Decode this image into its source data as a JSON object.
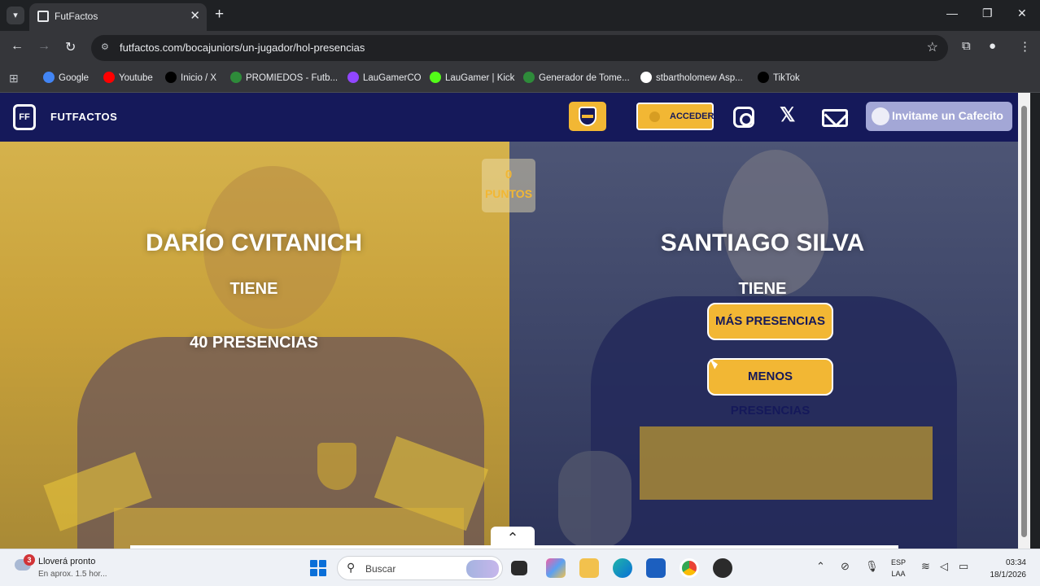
{
  "browser": {
    "tab_title": "FutFactos",
    "tab_close": "✕",
    "new_tab": "+",
    "tab_list_icon": "chevron-down-icon",
    "url": "futfactos.com/bocajuniors/un-jugador/hol-presencias",
    "window": {
      "minimize": "—",
      "maximize": "❐",
      "close": "✕"
    }
  },
  "bookmarks": [
    {
      "label": "Google",
      "icon": "google-icon",
      "color": "#4285f4"
    },
    {
      "label": "Youtube",
      "icon": "youtube-icon",
      "color": "#ff0000"
    },
    {
      "label": "Inicio / X",
      "icon": "x-icon",
      "color": "#000000"
    },
    {
      "label": "PROMIEDOS - Futb...",
      "icon": "promiedos-icon",
      "color": "#2e8b3a"
    },
    {
      "label": "LauGamerCO",
      "icon": "twitch-icon",
      "color": "#9146ff"
    },
    {
      "label": "LauGamer | Kick",
      "icon": "kick-icon",
      "color": "#53fc18"
    },
    {
      "label": "Generador de Tome...",
      "icon": "tournament-icon",
      "color": "#2e8b3a"
    },
    {
      "label": "stbartholomew Asp...",
      "icon": "flag-icon",
      "color": "#ffffff"
    },
    {
      "label": "TikTok",
      "icon": "tiktok-icon",
      "color": "#000000"
    }
  ],
  "site": {
    "brand": "FUTFACTOS",
    "logo_mark": "FF",
    "login_label": "ACCEDER",
    "coffee_label": "Invitame un Cafecito",
    "social_x": "𝕏",
    "accent_color": "#f2b734",
    "header_color": "#15195a"
  },
  "game": {
    "score_value": "0",
    "score_label": "PUNTOS",
    "left_player": {
      "name": "DARÍO CVITANICH",
      "has_label": "TIENE",
      "count_label": "40 PRESENCIAS"
    },
    "right_player": {
      "name": "SANTIAGO SILVA",
      "has_label": "TIENE"
    },
    "more_button": "MÁS PRESENCIAS",
    "less_button": "MENOS PRESENCIAS",
    "scroll_top": "⌃"
  },
  "taskbar": {
    "weather_title": "Lloverá pronto",
    "weather_sub": "En aprox. 1.5 hor...",
    "weather_badge": "3",
    "search_label": "Buscar",
    "lang_top": "ESP",
    "lang_bottom": "LAA",
    "time": "03:34",
    "date": "18/1/2026"
  }
}
